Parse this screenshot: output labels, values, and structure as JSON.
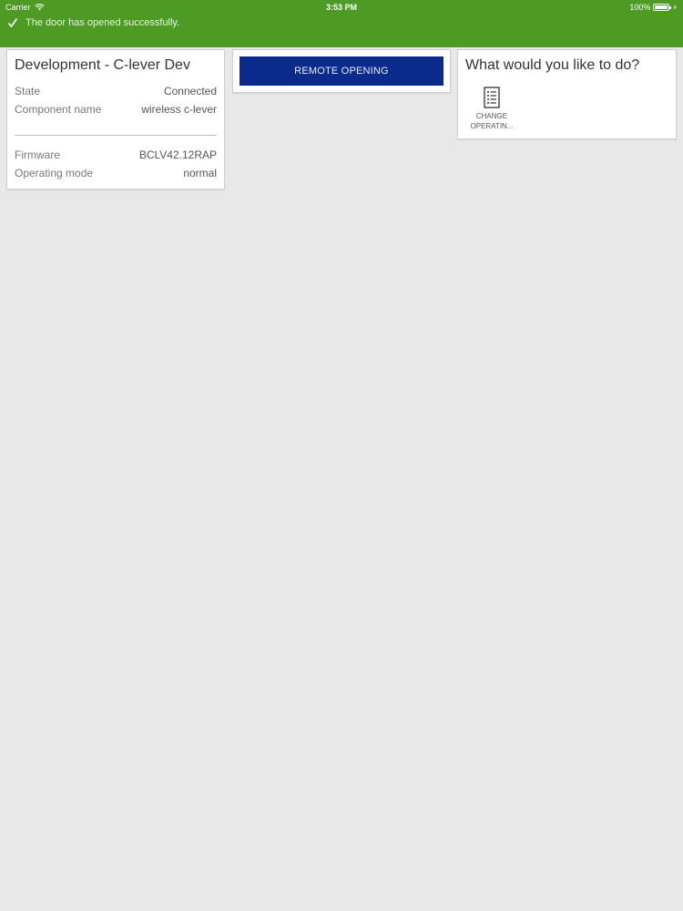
{
  "status_bar": {
    "carrier": "Carrier",
    "time": "3:53 PM",
    "battery_percent": "100%",
    "battery_level": 1.0
  },
  "notification": {
    "message": "The door has opened successfully."
  },
  "colors": {
    "header_green": "#4d9a24",
    "button_blue": "#0a2a8c",
    "background": "#e8e8e8"
  },
  "device_card": {
    "title": "Development - C-lever Dev",
    "rows_top": [
      {
        "label": "State",
        "value": "Connected"
      },
      {
        "label": "Component name",
        "value": "wireless c-lever"
      }
    ],
    "rows_bottom": [
      {
        "label": "Firmware",
        "value": "BCLV42.12RAP"
      },
      {
        "label": "Operating mode",
        "value": "normal"
      }
    ]
  },
  "remote": {
    "button_label": "REMOTE OPENING"
  },
  "actions": {
    "heading": "What would you like to do?",
    "items": [
      {
        "label_line1": "CHANGE",
        "label_line2": "OPERATIN...",
        "icon": "document-list-icon"
      }
    ]
  }
}
